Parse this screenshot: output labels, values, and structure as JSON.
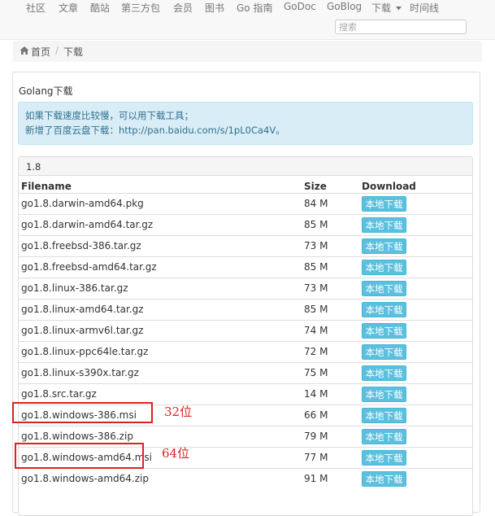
{
  "nav": {
    "items": [
      "社区",
      "文章",
      "酷站",
      "第三方包",
      "会员",
      "图书",
      "Go 指南",
      "GoDoc",
      "GoBlog",
      "下载",
      "时间线"
    ],
    "search_placeholder": "搜索"
  },
  "breadcrumb": {
    "home": "首页",
    "separator": "/",
    "current": "下载"
  },
  "page": {
    "title": "Golang下载",
    "alert_line1": "如果下载速度比较慢，可以用下载工具；",
    "alert_line2": "新增了百度云盘下载：http://pan.baidu.com/s/1pL0Ca4V。"
  },
  "version": {
    "label": "1.8",
    "headers": {
      "filename": "Filename",
      "size": "Size",
      "download": "Download"
    },
    "download_label": "本地下载",
    "files": [
      {
        "name": "go1.8.darwin-amd64.pkg",
        "size": "84 M"
      },
      {
        "name": "go1.8.darwin-amd64.tar.gz",
        "size": "85 M"
      },
      {
        "name": "go1.8.freebsd-386.tar.gz",
        "size": "73 M"
      },
      {
        "name": "go1.8.freebsd-amd64.tar.gz",
        "size": "85 M"
      },
      {
        "name": "go1.8.linux-386.tar.gz",
        "size": "73 M"
      },
      {
        "name": "go1.8.linux-amd64.tar.gz",
        "size": "85 M"
      },
      {
        "name": "go1.8.linux-armv6l.tar.gz",
        "size": "74 M"
      },
      {
        "name": "go1.8.linux-ppc64le.tar.gz",
        "size": "72 M"
      },
      {
        "name": "go1.8.linux-s390x.tar.gz",
        "size": "75 M"
      },
      {
        "name": "go1.8.src.tar.gz",
        "size": "14 M"
      },
      {
        "name": "go1.8.windows-386.msi",
        "size": "66 M"
      },
      {
        "name": "go1.8.windows-386.zip",
        "size": "79 M"
      },
      {
        "name": "go1.8.windows-amd64.msi",
        "size": "77 M"
      },
      {
        "name": "go1.8.windows-amd64.zip",
        "size": "91 M"
      }
    ]
  },
  "annotations": {
    "label_32": "32位",
    "label_64": "64位",
    "color": "#e02020"
  }
}
